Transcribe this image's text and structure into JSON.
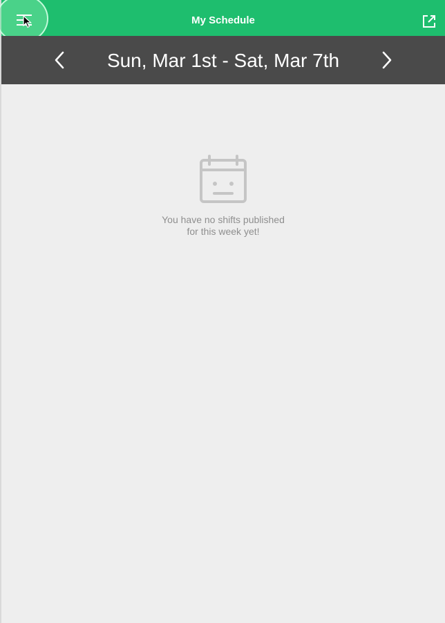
{
  "header": {
    "title": "My Schedule"
  },
  "week": {
    "range_label": "Sun, Mar 1st - Sat, Mar 7th"
  },
  "empty_state": {
    "line1": "You have no shifts published",
    "line2": "for this week yet!"
  },
  "icons": {
    "menu": "menu-icon",
    "external": "external-link-icon",
    "prev": "chevron-left-icon",
    "next": "chevron-right-icon",
    "calendar": "calendar-icon",
    "cursor": "cursor-icon"
  },
  "colors": {
    "primary": "#1ebe6e",
    "date_bar": "#4a4a4a",
    "background": "#eeeeee",
    "muted_text": "#8e8e8e"
  }
}
